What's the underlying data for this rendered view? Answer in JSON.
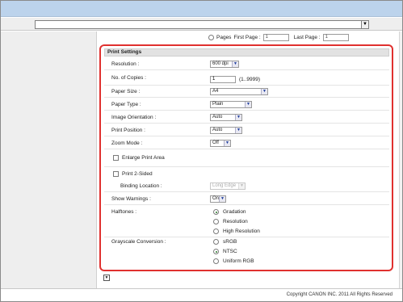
{
  "page_range": {
    "pages_label": "Pages",
    "first_page_label": "First Page :",
    "first_page_value": "1",
    "last_page_label": "Last Page :",
    "last_page_value": "1"
  },
  "panel": {
    "title": "Print Settings",
    "resolution": {
      "label": "Resolution :",
      "value": "600 dpi"
    },
    "copies": {
      "label": "No. of Copies :",
      "value": "1",
      "range": "(1..9999)"
    },
    "paper_size": {
      "label": "Paper Size :",
      "value": "A4"
    },
    "paper_type": {
      "label": "Paper Type :",
      "value": "Plain"
    },
    "orientation": {
      "label": "Image Orientation :",
      "value": "Auto"
    },
    "print_position": {
      "label": "Print Position :",
      "value": "Auto"
    },
    "zoom_mode": {
      "label": "Zoom Mode :",
      "value": "Off"
    },
    "enlarge": {
      "label": "Enlarge Print Area"
    },
    "two_sided": {
      "label": "Print 2-Sided"
    },
    "binding": {
      "label": "Binding Location :",
      "value": "Long Edge"
    },
    "warnings": {
      "label": "Show Warnings :",
      "value": "On"
    },
    "halftones": {
      "label": "Halftones :",
      "options": [
        "Gradation",
        "Resolution",
        "High Resolution"
      ]
    },
    "grayscale": {
      "label": "Grayscale Conversion :",
      "options": [
        "sRGB",
        "NTSC",
        "Uniform RGB"
      ]
    }
  },
  "footer": {
    "copyright": "Copyright CANON INC. 2011 All Rights Reserved"
  }
}
